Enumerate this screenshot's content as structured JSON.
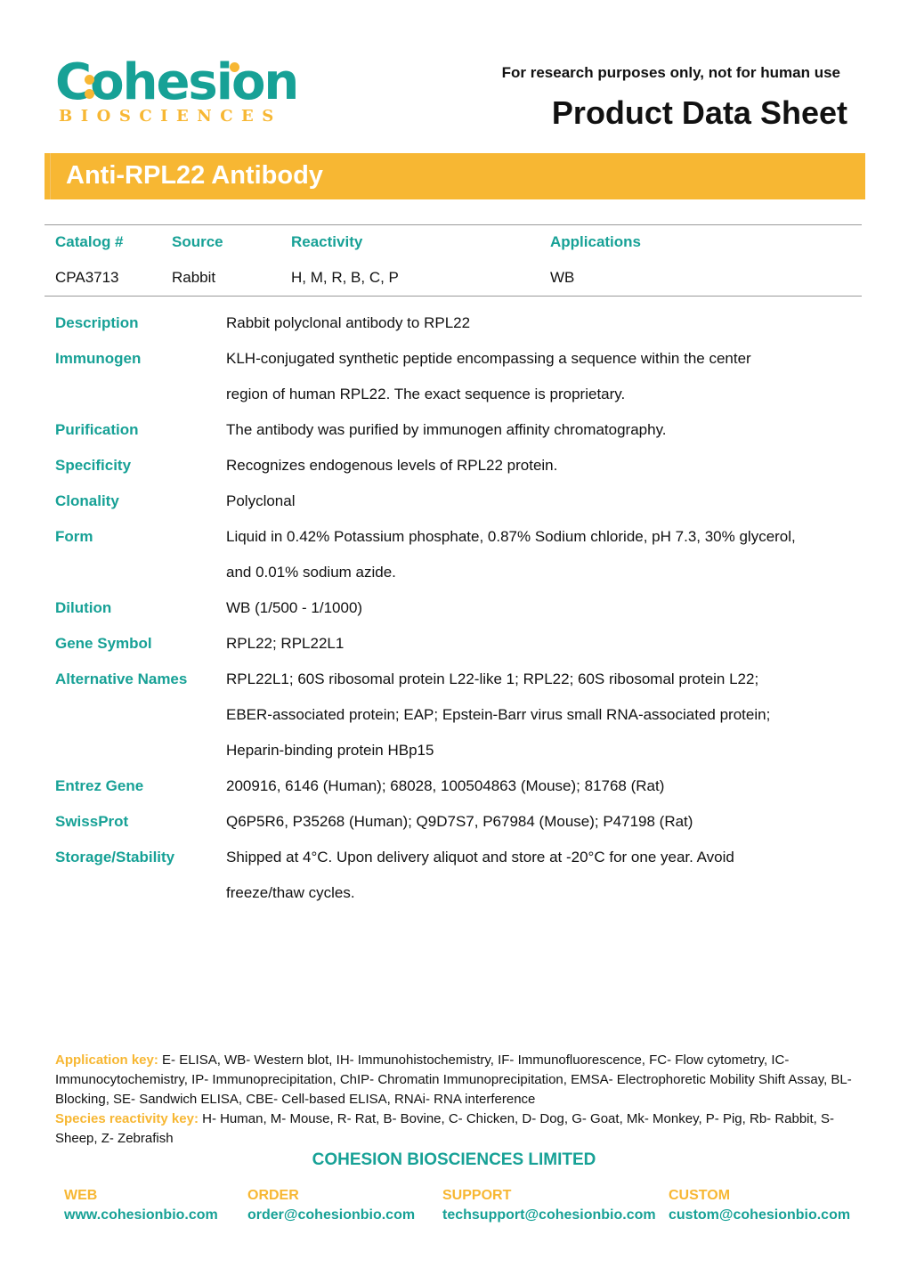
{
  "brand": {
    "logo_word": "Cohesion",
    "logo_sub": "BIOSCIENCES",
    "colors": {
      "teal": "#17a196",
      "gold": "#f7b733"
    }
  },
  "header": {
    "disclaimer": "For research purposes only, not for human use",
    "doc_title": "Product Data Sheet",
    "product_name": "Anti-RPL22 Antibody"
  },
  "summary": {
    "headers": [
      "Catalog #",
      "Source",
      "Reactivity",
      "Applications"
    ],
    "values": [
      "CPA3713",
      "Rabbit",
      "H, M, R, B, C, P",
      "WB"
    ]
  },
  "details": [
    {
      "label": "Description",
      "lines": [
        "Rabbit polyclonal antibody to RPL22"
      ]
    },
    {
      "label": "Immunogen",
      "lines": [
        "KLH-conjugated synthetic peptide encompassing a sequence within the center",
        "region of human RPL22. The exact sequence is proprietary."
      ]
    },
    {
      "label": "Purification",
      "lines": [
        "The antibody was purified by immunogen affinity chromatography."
      ]
    },
    {
      "label": "Specificity",
      "lines": [
        "Recognizes endogenous levels of RPL22 protein."
      ]
    },
    {
      "label": "Clonality",
      "lines": [
        "Polyclonal"
      ]
    },
    {
      "label": "Form",
      "lines": [
        "Liquid in 0.42% Potassium phosphate, 0.87% Sodium chloride, pH 7.3, 30% glycerol,",
        "and 0.01% sodium azide."
      ]
    },
    {
      "label": "Dilution",
      "lines": [
        "WB (1/500 - 1/1000)"
      ]
    },
    {
      "label": "Gene Symbol",
      "lines": [
        "RPL22; RPL22L1"
      ]
    },
    {
      "label": "Alternative Names",
      "lines": [
        "RPL22L1; 60S ribosomal protein L22-like 1; RPL22; 60S ribosomal protein L22;",
        "EBER-associated protein; EAP; Epstein-Barr virus small RNA-associated protein;",
        "Heparin-binding protein HBp15"
      ]
    },
    {
      "label": "Entrez Gene",
      "lines": [
        "200916, 6146 (Human); 68028, 100504863 (Mouse); 81768 (Rat)"
      ]
    },
    {
      "label": "SwissProt",
      "lines": [
        "Q6P5R6, P35268 (Human); Q9D7S7, P67984 (Mouse); P47198 (Rat)"
      ]
    },
    {
      "label": "Storage/Stability",
      "lines": [
        "Shipped at 4°C. Upon delivery aliquot and store at -20°C for one year. Avoid",
        "freeze/thaw cycles."
      ]
    }
  ],
  "keys": {
    "application_label": "Application key:",
    "application_text": "E- ELISA, WB- Western blot, IH- Immunohistochemistry, IF- Immunofluorescence, FC- Flow cytometry, IC- Immunocytochemistry, IP- Immunoprecipitation, ChIP- Chromatin Immunoprecipitation, EMSA- Electrophoretic Mobility Shift Assay, BL- Blocking, SE- Sandwich ELISA, CBE- Cell-based ELISA, RNAi- RNA interference",
    "species_label": "Species reactivity key:",
    "species_text": "H- Human, M- Mouse, R- Rat, B- Bovine, C- Chicken, D- Dog, G- Goat, Mk- Monkey, P- Pig, Rb- Rabbit, S- Sheep, Z- Zebrafish"
  },
  "footer": {
    "company": "COHESION BIOSCIENCES LIMITED",
    "contacts": [
      {
        "label": "WEB",
        "value": "www.cohesionbio.com"
      },
      {
        "label": "ORDER",
        "value": "order@cohesionbio.com"
      },
      {
        "label": "SUPPORT",
        "value": "techsupport@cohesionbio.com"
      },
      {
        "label": "CUSTOM",
        "value": "custom@cohesionbio.com"
      }
    ]
  }
}
